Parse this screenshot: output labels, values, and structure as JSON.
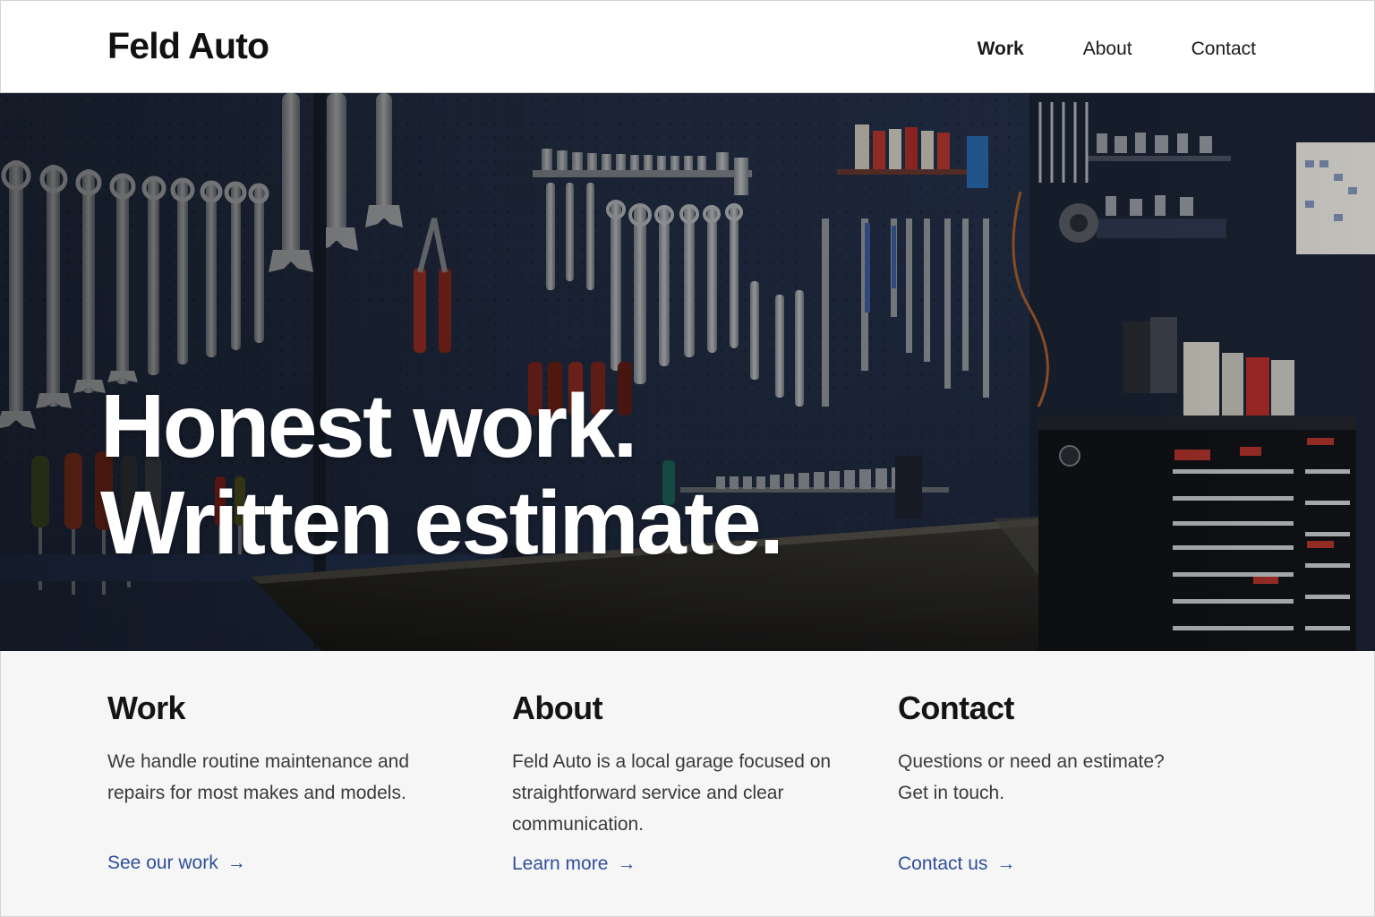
{
  "header": {
    "brand": "Feld Auto",
    "nav": [
      {
        "label": "Work",
        "active": true
      },
      {
        "label": "About",
        "active": false
      },
      {
        "label": "Contact",
        "active": false
      }
    ]
  },
  "hero": {
    "title_line1": "Honest work.",
    "title_line2": "Written estimate."
  },
  "features": [
    {
      "title": "Work",
      "body": "We handle routine maintenance and repairs for most makes and models.",
      "link": "See our work",
      "arrow": "→"
    },
    {
      "title": "About",
      "body": "Feld Auto is a local garage focused on straightforward service and clear communication.",
      "link": "Learn more",
      "arrow": "→"
    },
    {
      "title": "Contact",
      "body": "Questions or need an estimate? Get in touch.",
      "link": "Contact us",
      "arrow": "→"
    }
  ],
  "colors": {
    "link": "#2f4f9a",
    "pegboard": "#26334d",
    "features_bg": "#f6f6f6"
  }
}
